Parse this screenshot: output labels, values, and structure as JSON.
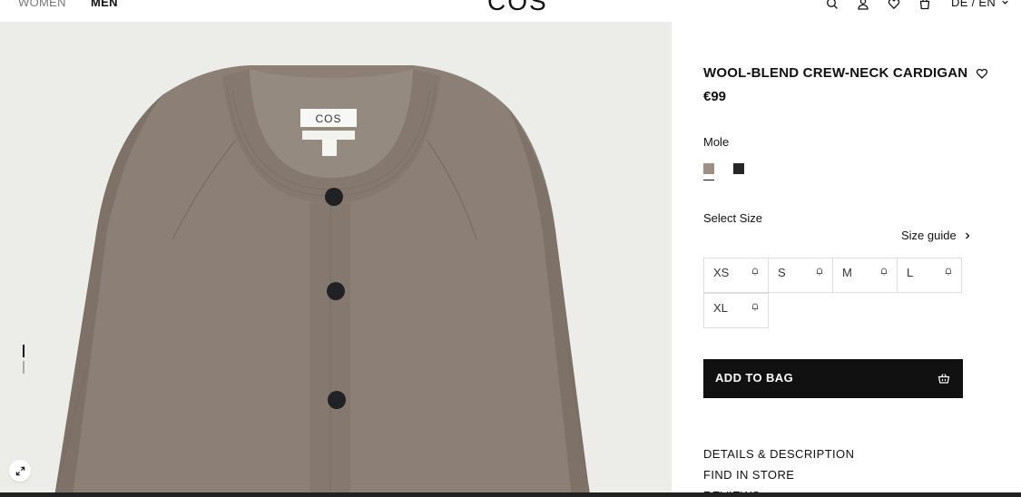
{
  "header": {
    "nav": [
      {
        "label": "WOMEN"
      },
      {
        "label": "MEN"
      }
    ],
    "logo": "COS",
    "icons": [
      "search-icon",
      "account-icon",
      "wishlist-icon",
      "bag-icon"
    ],
    "language": "DE / EN"
  },
  "gallery": {
    "product_label_text": "COS",
    "image_count_indicators": 2,
    "expand_icon": "expand-icon"
  },
  "product": {
    "title": "WOOL-BLEND CREW-NECK CARDIGAN",
    "price": "€99",
    "color_name": "Mole",
    "swatches": [
      {
        "name": "Mole",
        "color": "#9c8f84",
        "selected": true
      },
      {
        "name": "Black",
        "color": "#262626",
        "selected": false
      }
    ],
    "select_size_label": "Select Size",
    "size_guide_label": "Size guide",
    "sizes": [
      {
        "label": "XS"
      },
      {
        "label": "S"
      },
      {
        "label": "M"
      },
      {
        "label": "L"
      },
      {
        "label": "XL"
      }
    ],
    "add_to_bag_label": "ADD TO BAG",
    "accordions": [
      {
        "label": "DETAILS & DESCRIPTION"
      },
      {
        "label": "FIND IN STORE"
      },
      {
        "label": "REVIEWS"
      }
    ]
  }
}
